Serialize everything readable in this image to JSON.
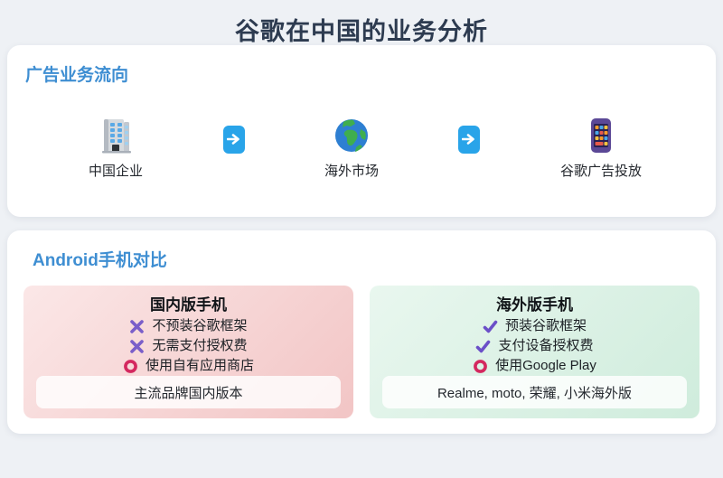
{
  "page": {
    "title": "谷歌在中国的业务分析"
  },
  "colors": {
    "background": "#eef1f5",
    "card": "#ffffff",
    "title_text": "#2d3b50",
    "accent_blue": "#3e8ed2",
    "arrow_blue": "#29a4e9",
    "cross_purple": "#7a5ec9",
    "check_purple": "#6b4fc8",
    "circle_red": "#d4285f",
    "pink_card_gradient": [
      "#fbe7e7",
      "#f2c5c5"
    ],
    "green_card_gradient": [
      "#e9f7ef",
      "#cfecdc"
    ]
  },
  "flow": {
    "heading": "广告业务流向",
    "steps": [
      {
        "icon": "office-building-icon",
        "label": "中国企业"
      },
      {
        "icon": "globe-icon",
        "label": "海外市场"
      },
      {
        "icon": "ad-phone-icon",
        "label": "谷歌广告投放"
      }
    ],
    "connector_icon": "right-arrow-icon"
  },
  "comparison": {
    "heading": "Android手机对比",
    "domestic": {
      "title": "国内版手机",
      "items": [
        {
          "icon": "cross-icon",
          "text": "不预装谷歌框架"
        },
        {
          "icon": "cross-icon",
          "text": "无需支付授权费"
        },
        {
          "icon": "circle-icon",
          "text": "使用自有应用商店"
        }
      ],
      "footer": "主流品牌国内版本"
    },
    "overseas": {
      "title": "海外版手机",
      "items": [
        {
          "icon": "check-icon",
          "text": "预装谷歌框架"
        },
        {
          "icon": "check-icon",
          "text": "支付设备授权费"
        },
        {
          "icon": "circle-icon",
          "text": "使用Google Play"
        }
      ],
      "footer": "Realme, moto, 荣耀, 小米海外版"
    }
  }
}
